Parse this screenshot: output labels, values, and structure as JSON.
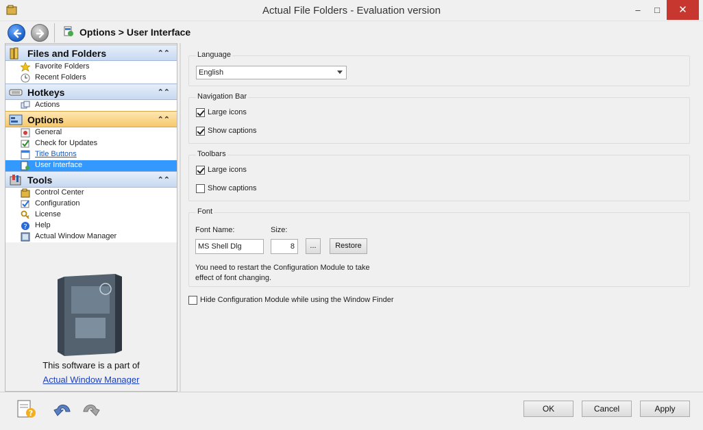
{
  "window": {
    "title": "Actual File Folders - Evaluation version",
    "minimize": "–",
    "maximize": "□",
    "close": "✕"
  },
  "nav": {
    "breadcrumb": "Options > User Interface",
    "icons": [
      "back-arrow-icon",
      "forward-arrow-icon"
    ]
  },
  "sidebar": {
    "groups": [
      {
        "title": "Files and Folders",
        "icon": "folders-icon",
        "items": [
          {
            "label": "Favorite Folders",
            "icon": "star-icon"
          },
          {
            "label": "Recent Folders",
            "icon": "clock-icon"
          }
        ]
      },
      {
        "title": "Hotkeys",
        "icon": "keyboard-icon",
        "items": [
          {
            "label": "Actions",
            "icon": "keys-icon"
          }
        ]
      },
      {
        "title": "Options",
        "icon": "options-icon",
        "items": [
          {
            "label": "General",
            "icon": "general-icon"
          },
          {
            "label": "Check for Updates",
            "icon": "update-icon"
          },
          {
            "label": "Title Buttons",
            "icon": "title-buttons-icon"
          },
          {
            "label": "User Interface",
            "icon": "user-interface-icon"
          }
        ]
      },
      {
        "title": "Tools",
        "icon": "tools-icon",
        "items": [
          {
            "label": "Control Center",
            "icon": "control-center-icon"
          },
          {
            "label": "Configuration",
            "icon": "configuration-icon"
          },
          {
            "label": "License",
            "icon": "license-icon"
          },
          {
            "label": "Help",
            "icon": "help-icon"
          },
          {
            "label": "Actual Window Manager",
            "icon": "window-manager-icon"
          }
        ]
      }
    ],
    "promo_text": "This software is a part of",
    "promo_link": "Actual Window Manager"
  },
  "content": {
    "language": {
      "title": "Language",
      "value": "English"
    },
    "navigation_bar": {
      "title": "Navigation Bar",
      "large_icons": "Large icons",
      "large_icons_checked": true,
      "show_captions": "Show captions",
      "show_captions_checked": true
    },
    "toolbars": {
      "title": "Toolbars",
      "large_icons": "Large icons",
      "large_icons_checked": true,
      "show_captions": "Show captions",
      "show_captions_checked": false
    },
    "font": {
      "title": "Font",
      "name_label": "Font Name:",
      "size_label": "Size:",
      "name_value": "MS Shell Dlg",
      "size_value": "8",
      "browse_label": "...",
      "restore_label": "Restore",
      "note": "You need to restart the Configuration Module to take effect of font changing."
    },
    "hide_module": {
      "label": "Hide Configuration Module while using the Window Finder",
      "checked": false
    }
  },
  "footer": {
    "ok": "OK",
    "cancel": "Cancel",
    "apply": "Apply",
    "icons": [
      "help-document-icon",
      "undo-icon",
      "redo-icon"
    ]
  }
}
